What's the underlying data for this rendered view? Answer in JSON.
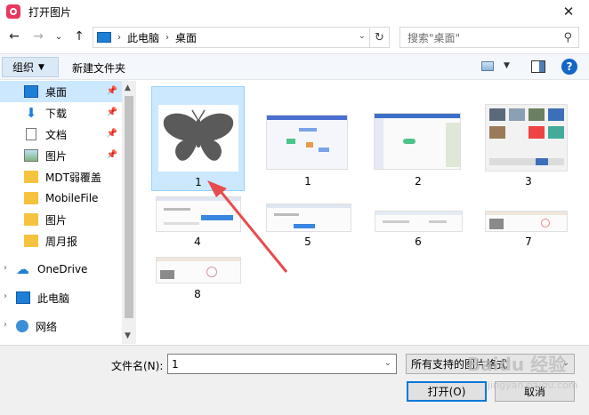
{
  "window": {
    "title": "打开图片",
    "close_glyph": "✕"
  },
  "nav": {
    "back": "←",
    "forward": "→",
    "history": "⌄",
    "up": "↑",
    "breadcrumb": [
      "此电脑",
      "桌面"
    ],
    "refresh": "↻",
    "search_placeholder": "搜索\"桌面\""
  },
  "toolbar": {
    "organize": "组织",
    "new_folder": "新建文件夹",
    "help": "?"
  },
  "sidebar": {
    "items": [
      {
        "label": "桌面",
        "icon": "desktop-icon",
        "pinned": true,
        "selected": true
      },
      {
        "label": "下载",
        "icon": "download-icon",
        "pinned": true
      },
      {
        "label": "文档",
        "icon": "document-icon",
        "pinned": true
      },
      {
        "label": "图片",
        "icon": "pictures-icon",
        "pinned": true
      },
      {
        "label": "MDT弱覆盖",
        "icon": "folder-icon"
      },
      {
        "label": "MobileFile",
        "icon": "folder-icon"
      },
      {
        "label": "图片",
        "icon": "folder-icon"
      },
      {
        "label": "周月报",
        "icon": "folder-icon"
      },
      {
        "label": "OneDrive",
        "icon": "cloud-icon"
      },
      {
        "label": "此电脑",
        "icon": "computer-icon"
      },
      {
        "label": "网络",
        "icon": "network-icon"
      }
    ]
  },
  "files": [
    {
      "name": "1",
      "kind": "butterfly",
      "selected": true
    },
    {
      "name": "1",
      "kind": "mindmap"
    },
    {
      "name": "2",
      "kind": "mindmap2"
    },
    {
      "name": "3",
      "kind": "gallery"
    },
    {
      "name": "4",
      "kind": "webpage"
    },
    {
      "name": "5",
      "kind": "webpage"
    },
    {
      "name": "6",
      "kind": "webpage"
    },
    {
      "name": "7",
      "kind": "webpage"
    },
    {
      "name": "8",
      "kind": "webpage"
    }
  ],
  "bottom": {
    "filename_label": "文件名(N):",
    "filename_value": "1",
    "filter_value": "所有支持的图片格式",
    "open_button": "打开(O)",
    "cancel_button": "取消"
  },
  "watermark": {
    "line1": "Baidu 经验",
    "line2": "jingyan.baidu.com"
  },
  "colors": {
    "selection": "#cce8ff",
    "accent": "#0078d7",
    "annotation_arrow": "#e84c4c"
  }
}
